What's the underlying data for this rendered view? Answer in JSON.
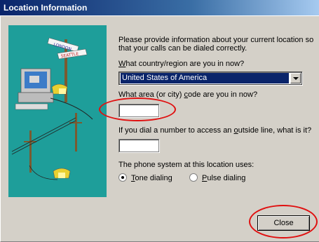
{
  "window": {
    "title": "Location Information"
  },
  "illustration": {
    "sign_top": "LONDON",
    "sign_bottom": "SEATTLE",
    "bg_color": "#1e9e9a"
  },
  "instruction": "Please provide information about your current location so that your calls can be dialed correctly.",
  "country": {
    "label_pre": "",
    "label_u": "W",
    "label_post": "hat country/region are you in now?",
    "selected": "United States of America"
  },
  "area_code": {
    "label_pre": "What area (or city) ",
    "label_u": "c",
    "label_post": "ode are you in now?",
    "value": ""
  },
  "outside_line": {
    "label_pre": "If you dial a number to access an ",
    "label_u": "o",
    "label_post": "utside line, what is it?",
    "value": ""
  },
  "phone_system": {
    "label": "The phone system at this location uses:",
    "tone": {
      "u": "T",
      "rest": "one dialing",
      "checked": true
    },
    "pulse": {
      "u": "P",
      "rest": "ulse dialing",
      "checked": false
    }
  },
  "buttons": {
    "close": "Close"
  },
  "colors": {
    "titlebar": "#0a246a",
    "annotation": "#e01010",
    "dialog": "#d4d0c8"
  }
}
